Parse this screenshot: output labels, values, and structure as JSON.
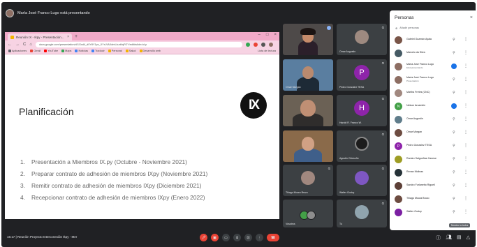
{
  "presenter_bar": {
    "text": "María José Franco Lugo está presentando"
  },
  "browser": {
    "tab_title": "Reunión IX - Ikpy - Presentación...",
    "tab_close": "×",
    "new_tab": "+",
    "window_controls": [
      "–",
      "□",
      "×"
    ],
    "nav": [
      "←",
      "→",
      "C",
      "⌂"
    ],
    "url": "docs.google.com/presentation/d/1Gxd4_d0Y8Y1pv_XYrLVAXdmLkurkfqFOY/edit#slide=id.p",
    "bookmarks": [
      "Aplicaciones",
      "Gmail",
      "YouTube",
      "Maps",
      "Noticias",
      "Traducir",
      "Personal",
      "Salud",
      "Desarrollo web"
    ],
    "bookmark_right": "Lista de lectura"
  },
  "slide": {
    "title": "Planificación",
    "logo_text": "IX",
    "items": [
      {
        "num": "1.",
        "text": "Presentación a Miembros IX.py (Octubre - Noviembre 2021)"
      },
      {
        "num": "2.",
        "text": "Preparar contrato de adhesión de miembros IXpy (Noviembre 2021)"
      },
      {
        "num": "3.",
        "text": "Remitir contrato de adhesión de miembros IXpy (Diciembre 2021)"
      },
      {
        "num": "4.",
        "text": "Recepcionar contrato de adhesión de miembros IXpy (Enero 2022)"
      }
    ]
  },
  "tiles": {
    "t1": {
      "name": ""
    },
    "t2": {
      "name": "Omar Augustin"
    },
    "t3": {
      "name": "Omar Morgan"
    },
    "t4": {
      "name": "Pedro Gonzalez TESA",
      "letter": "P"
    },
    "t5": {
      "name": ""
    },
    "t6": {
      "name": "Harold R. Franco W.",
      "letter": "H"
    },
    "t7": {
      "name": ""
    },
    "t8": {
      "name": "Agustín Chiesoño"
    },
    "t9": {
      "name": "Thiago Moura Brozo"
    },
    "t10": {
      "name": "Walter Godoy"
    },
    "t11": {
      "name": "Vosotros"
    },
    "t12": {
      "name": "Tú"
    }
  },
  "bottom": {
    "time_meeting": "16:17  |  Reunión Proyecto Interconexión Ikpy - Mer",
    "tooltip": "Mostrar a todos"
  },
  "people": {
    "title": "Personas",
    "close": "×",
    "add_label": "Añadir personas",
    "pin_icon": "⚲",
    "more_icon": "⋮",
    "list": [
      {
        "name": "Gabriel Guzmán Ayala",
        "sub": "",
        "color": "#795548",
        "letter": "",
        "speaking": false
      },
      {
        "name": "Marcelo da Silva",
        "sub": "",
        "color": "#455a64",
        "letter": "",
        "speaking": false
      },
      {
        "name": "María José Franco Lugo",
        "sub": "Está presentando",
        "color": "#8d6e63",
        "letter": "",
        "speaking": true
      },
      {
        "name": "María José Franco Lugo",
        "sub": "Presentación",
        "color": "#8d6e63",
        "letter": "",
        "speaking": false
      },
      {
        "name": "Martha Fretes (CNC)",
        "sub": "",
        "color": "#a1887f",
        "letter": "",
        "speaking": false
      },
      {
        "name": "Nelson Arzamkin",
        "sub": "",
        "color": "#43a047",
        "letter": "N",
        "speaking": true
      },
      {
        "name": "Omar Augustin",
        "sub": "",
        "color": "#607d8b",
        "letter": "",
        "speaking": false
      },
      {
        "name": "Omar Morgan",
        "sub": "",
        "color": "#6d4c41",
        "letter": "",
        "speaking": false
      },
      {
        "name": "Pedro Gonzalez TESA",
        "sub": "",
        "color": "#8e24aa",
        "letter": "P",
        "speaking": false
      },
      {
        "name": "Ramiro Salgueñas Canese",
        "sub": "",
        "color": "#9e9d24",
        "letter": "",
        "speaking": false
      },
      {
        "name": "Renan Molinas",
        "sub": "",
        "color": "#263238",
        "letter": "",
        "speaking": false
      },
      {
        "name": "Sandro Furlanetto Riguell",
        "sub": "",
        "color": "#5d4037",
        "letter": "",
        "speaking": false
      },
      {
        "name": "Thiago Moura Brozo",
        "sub": "",
        "color": "#6d4c41",
        "letter": "",
        "speaking": false
      },
      {
        "name": "Walter Godoy",
        "sub": "",
        "color": "#7b1fa2",
        "letter": "",
        "speaking": false
      }
    ]
  }
}
